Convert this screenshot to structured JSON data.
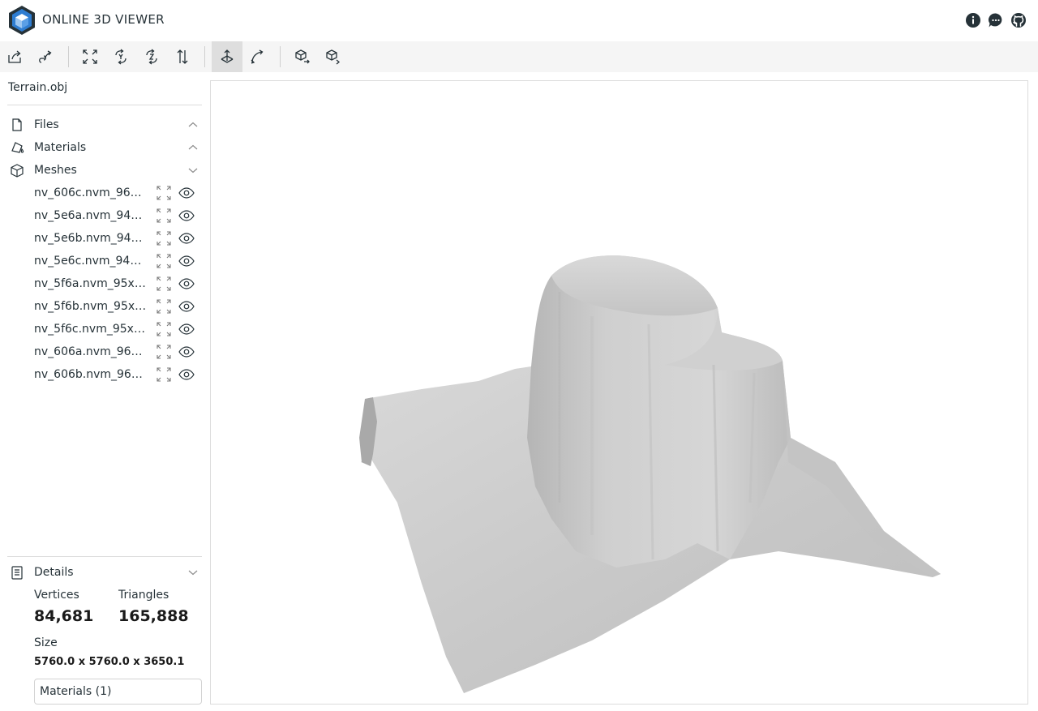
{
  "app": {
    "title": "ONLINE 3D VIEWER",
    "header_icons": [
      "info-icon",
      "feedback-icon",
      "github-icon"
    ]
  },
  "toolbar": {
    "buttons": [
      {
        "name": "open-button",
        "icon": "open-file-icon"
      },
      {
        "name": "open-url-button",
        "icon": "open-url-icon"
      },
      {
        "name": "fit-to-window-button",
        "icon": "fit-icon"
      },
      {
        "name": "set-up-y-button",
        "icon": "rotate-y-icon"
      },
      {
        "name": "set-up-z-button",
        "icon": "rotate-z-icon"
      },
      {
        "name": "flip-up-button",
        "icon": "flip-icon"
      },
      {
        "name": "fixed-up-vector-button",
        "icon": "fixed-up-icon",
        "active": true
      },
      {
        "name": "free-orbit-button",
        "icon": "free-orbit-icon"
      },
      {
        "name": "export-button",
        "icon": "export-icon"
      },
      {
        "name": "share-button",
        "icon": "share-icon"
      }
    ]
  },
  "sidebar": {
    "file_name": "Terrain.obj",
    "sections": {
      "files": {
        "label": "Files",
        "icon": "file-icon"
      },
      "materials": {
        "label": "Materials",
        "icon": "materials-icon"
      },
      "meshes": {
        "label": "Meshes",
        "icon": "cube-icon"
      }
    },
    "meshes": [
      "nv_606c.nvm_96…",
      "nv_5e6a.nvm_94…",
      "nv_5e6b.nvm_94…",
      "nv_5e6c.nvm_94…",
      "nv_5f6a.nvm_95x…",
      "nv_5f6b.nvm_95x…",
      "nv_5f6c.nvm_95x…",
      "nv_606a.nvm_96…",
      "nv_606b.nvm_96…"
    ],
    "details": {
      "label": "Details",
      "vertices_label": "Vertices",
      "vertices_value": "84,681",
      "triangles_label": "Triangles",
      "triangles_value": "165,888",
      "size_label": "Size",
      "size_value": "5760.0 x 5760.0 x 3650.1",
      "materials_button": "Materials (1)"
    }
  },
  "colors": {
    "accent": "#263238",
    "toolbar_bg": "#f5f5f5",
    "active_button_bg": "#dedede",
    "mesh_fill": "#c8c8c8"
  }
}
